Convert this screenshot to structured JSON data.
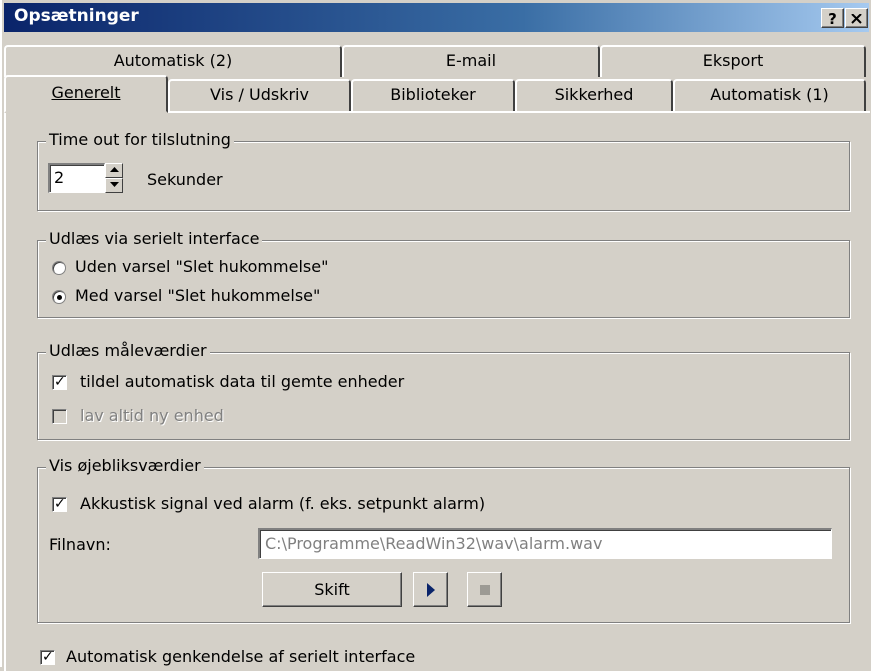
{
  "window": {
    "title": "Opsætninger",
    "help_label": "?",
    "close_label": "✕"
  },
  "tabs_back": [
    {
      "label": "Automatisk (2)"
    },
    {
      "label": "E-mail"
    },
    {
      "label": "Eksport"
    }
  ],
  "tabs_front": [
    {
      "label": "Generelt",
      "active": true
    },
    {
      "label": "Vis / Udskriv"
    },
    {
      "label": "Biblioteker"
    },
    {
      "label": "Sikkerhed"
    },
    {
      "label": "Automatisk (1)"
    }
  ],
  "timeout": {
    "legend": "Time out for tilslutning",
    "value": "2",
    "unit": "Sekunder"
  },
  "serial": {
    "legend": "Udlæs via serielt interface",
    "options": [
      {
        "label": "Uden varsel \"Slet hukommelse\"",
        "selected": false
      },
      {
        "label": "Med varsel \"Slet hukommelse\"",
        "selected": true
      }
    ]
  },
  "measure": {
    "legend": "Udlæs måleværdier",
    "assign_label": "tildel automatisk data til gemte enheder",
    "assign_checked": true,
    "new_unit_label": "lav altid ny enhed",
    "new_unit_checked": false,
    "new_unit_enabled": false
  },
  "live": {
    "legend": "Vis øjebliksværdier",
    "signal_label": "Akkustisk signal ved alarm (f. eks. setpunkt alarm)",
    "signal_checked": true,
    "filename_label": "Filnavn:",
    "filename_value": "C:\\Programme\\ReadWin32\\wav\\alarm.wav",
    "change_button": "Skift",
    "play_icon": "play-icon",
    "stop_icon": "stop-icon"
  },
  "auto_detect": {
    "label": "Automatisk genkendelse af serielt interface",
    "checked": true
  }
}
